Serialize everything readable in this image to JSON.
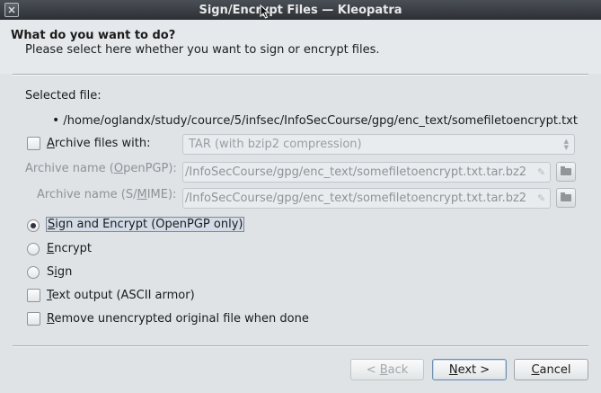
{
  "window": {
    "title": "Sign/Encrypt Files — Kleopatra"
  },
  "header": {
    "title": "What do you want to do?",
    "subtitle": "Please select here whether you want to sign or encrypt files."
  },
  "selected_file": {
    "label": "Selected file:",
    "bullet": "•",
    "path": "/home/oglandx/study/cource/5/infsec/InfoSecCourse/gpg/enc_text/somefiletoencrypt.txt"
  },
  "archive": {
    "checkbox_label_rest": "rchive files with:",
    "checkbox_label_mnemonic": "A",
    "checked": false,
    "format_value": "TAR (with bzip2 compression)",
    "openpgp_label_prefix": "Archive name (",
    "openpgp_label_mnemonic": "O",
    "openpgp_label_suffix": "penPGP):",
    "openpgp_value": "/InfoSecCourse/gpg/enc_text/somefiletoencrypt.txt.tar.bz2",
    "smime_label_prefix": "Archive name (S/",
    "smime_label_mnemonic": "M",
    "smime_label_suffix": "IME):",
    "smime_value": "/InfoSecCourse/gpg/enc_text/somefiletoencrypt.txt.tar.bz2"
  },
  "operation": {
    "selected": "sign_and_encrypt",
    "sign_and_encrypt_mnemonic": "S",
    "sign_and_encrypt_rest": "ign and Encrypt (OpenPGP only)",
    "encrypt_mnemonic": "E",
    "encrypt_rest": "ncrypt",
    "sign_prefix": "S",
    "sign_mnemonic": "i",
    "sign_suffix": "gn"
  },
  "options": {
    "text_output_mnemonic": "T",
    "text_output_rest": "ext output (ASCII armor)",
    "text_output_checked": false,
    "remove_mnemonic": "R",
    "remove_rest": "emove unencrypted original file when done",
    "remove_checked": false
  },
  "buttons": {
    "back_prefix": "< ",
    "back_mnemonic": "B",
    "back_rest": "ack",
    "next_mnemonic": "N",
    "next_rest": "ext >",
    "cancel_mnemonic": "C",
    "cancel_rest": "ancel"
  },
  "colors": {
    "title_bar": "#3a3f45",
    "background": "#dfe3e6",
    "focus": "#d2dbe6"
  }
}
